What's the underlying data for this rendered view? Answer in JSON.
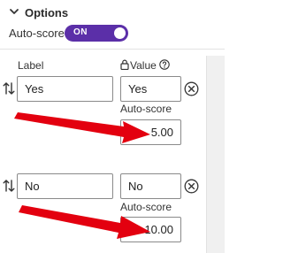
{
  "section": {
    "title": "Options",
    "expanded": true,
    "icon": "chevron-down-icon"
  },
  "auto_score": {
    "label": "Auto-score",
    "toggle_text": "ON",
    "on": true,
    "color": "#5b2fa8"
  },
  "columns": {
    "label": "Label",
    "value": "Value",
    "lock_icon": "lock-icon",
    "help_icon": "help-icon"
  },
  "options": [
    {
      "label": "Yes",
      "value": "Yes",
      "autoscore_label": "Auto-score",
      "autoscore": "5.00"
    },
    {
      "label": "No",
      "value": "No",
      "autoscore_label": "Auto-score",
      "autoscore": "10.00"
    }
  ],
  "annotation": {
    "arrow_color": "#e3000f"
  }
}
